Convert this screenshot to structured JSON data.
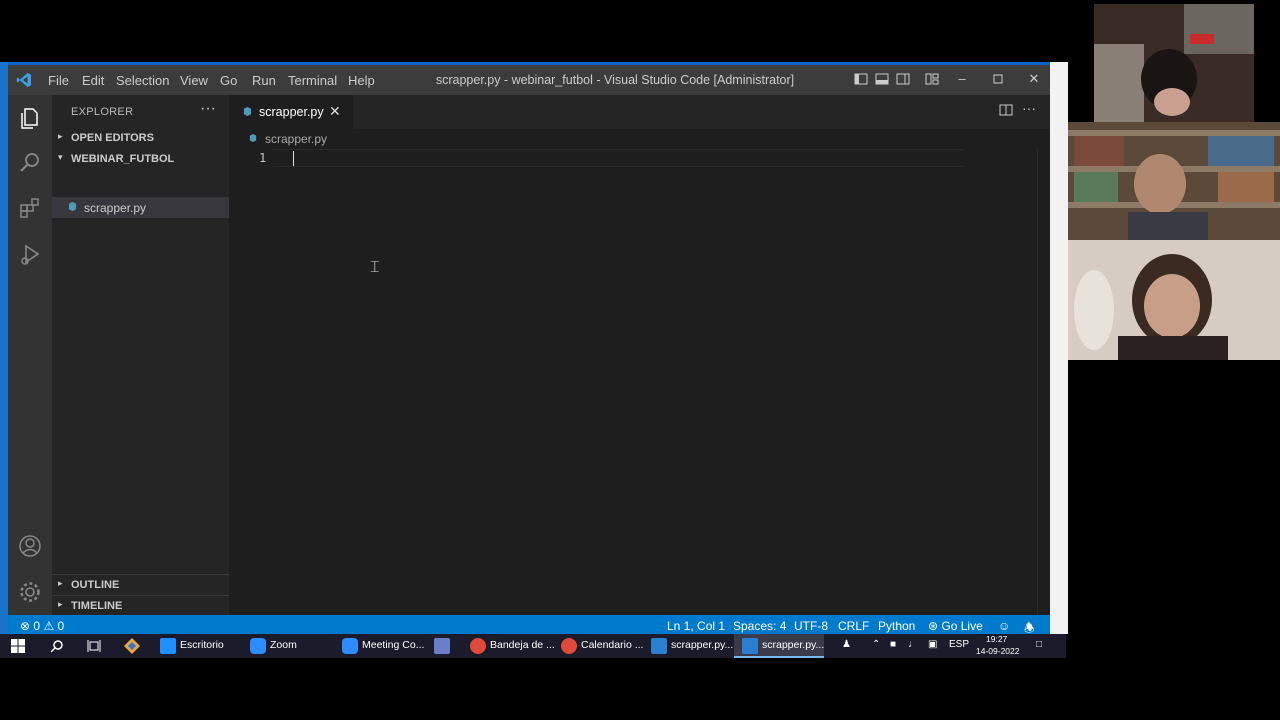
{
  "window": {
    "title": "scrapper.py - webinar_futbol - Visual Studio Code [Administrator]",
    "menu": [
      "File",
      "Edit",
      "Selection",
      "View",
      "Go",
      "Run",
      "Terminal",
      "Help"
    ]
  },
  "sidebar": {
    "header": "EXPLORER",
    "open_editors": "OPEN EDITORS",
    "folder": "WEBINAR_FUTBOL",
    "file": "scrapper.py",
    "outline": "OUTLINE",
    "timeline": "TIMELINE"
  },
  "editor": {
    "tab_name": "scrapper.py",
    "breadcrumb": "scrapper.py",
    "line_number": "1"
  },
  "statusbar": {
    "errors": "0",
    "warnings": "0",
    "position": "Ln 1, Col 1",
    "spaces": "Spaces: 4",
    "encoding": "UTF-8",
    "eol": "CRLF",
    "language": "Python",
    "golive": "Go Live"
  },
  "taskbar": {
    "items": [
      "Escritorio",
      "Zoom",
      "Meeting Co...",
      "Bandeja de ...",
      "Calendario ...",
      "scrapper.py...",
      "scrapper.py..."
    ],
    "lang": "ESP",
    "time": "19:27",
    "date": "14-09-2022"
  },
  "colors": {
    "accent": "#007acc",
    "titlebar": "#3c3c3c",
    "sidebar": "#252526",
    "editor": "#1e1e1e"
  }
}
